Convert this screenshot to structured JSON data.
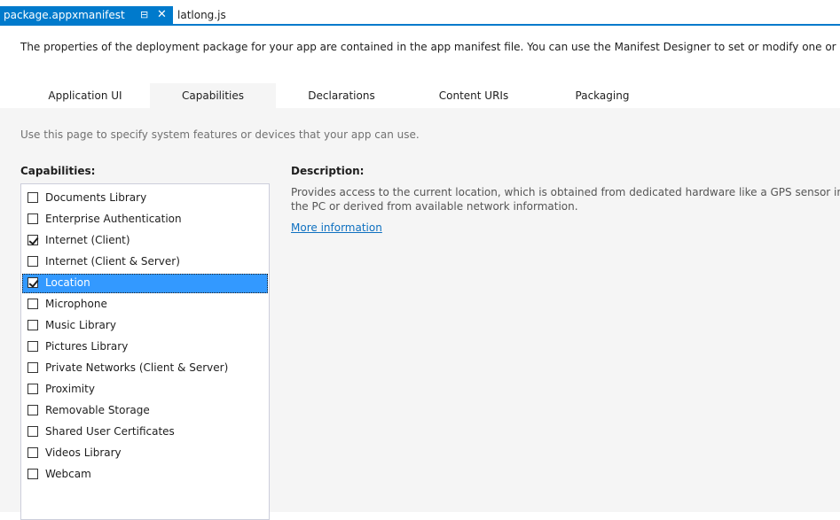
{
  "doc_tabs": [
    {
      "label": "package.appxmanifest",
      "pin_icon": "⊟",
      "close_icon": "✕"
    },
    {
      "label": "latlong.js"
    }
  ],
  "intro_text": "The properties of the deployment package for your app are contained in the app manifest file. You can use the Manifest Designer to set or modify one or m",
  "section_tabs": [
    "Application UI",
    "Capabilities",
    "Declarations",
    "Content URIs",
    "Packaging"
  ],
  "selected_section_tab": "Capabilities",
  "hint_text": "Use this page to specify system features or devices that your app can use.",
  "capabilities_heading": "Capabilities:",
  "capabilities": [
    {
      "label": "Documents Library",
      "checked": false
    },
    {
      "label": "Enterprise Authentication",
      "checked": false
    },
    {
      "label": "Internet (Client)",
      "checked": true
    },
    {
      "label": "Internet (Client & Server)",
      "checked": false
    },
    {
      "label": "Location",
      "checked": true,
      "selected": true
    },
    {
      "label": "Microphone",
      "checked": false
    },
    {
      "label": "Music Library",
      "checked": false
    },
    {
      "label": "Pictures Library",
      "checked": false
    },
    {
      "label": "Private Networks (Client & Server)",
      "checked": false
    },
    {
      "label": "Proximity",
      "checked": false
    },
    {
      "label": "Removable Storage",
      "checked": false
    },
    {
      "label": "Shared User Certificates",
      "checked": false
    },
    {
      "label": "Videos Library",
      "checked": false
    },
    {
      "label": "Webcam",
      "checked": false
    }
  ],
  "description_heading": "Description:",
  "description_text": "Provides access to the current location, which is obtained from dedicated hardware like a GPS sensor in the PC or derived from available network information.",
  "more_info_link": "More information",
  "colors": {
    "accent": "#007acc",
    "selection": "#3399ff",
    "panel_bg": "#f5f5f5",
    "link": "#0e70c0"
  }
}
